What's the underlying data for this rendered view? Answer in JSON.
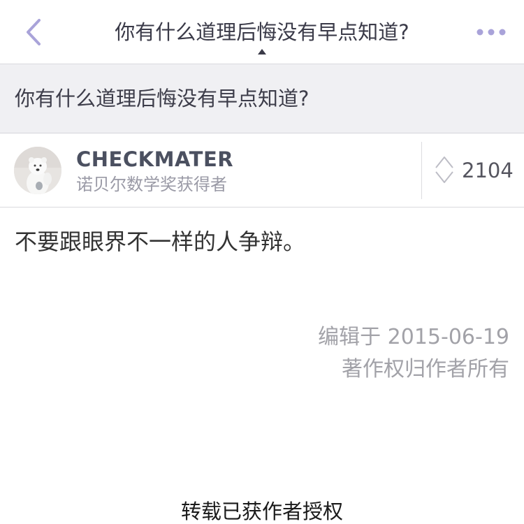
{
  "navbar": {
    "back_icon": "chevron-left-icon",
    "title": "你有什么道理后悔没有早点知道?",
    "more_icon": "ellipsis-icon"
  },
  "question": {
    "text": "你有什么道理后悔没有早点知道?"
  },
  "author": {
    "name": "CHECKMATER",
    "title": "诺贝尔数学奖获得者",
    "avatar_icon": "polar-bear-avatar"
  },
  "votes": {
    "icon": "vote-arrows-icon",
    "count": "2104"
  },
  "answer": {
    "text": "不要跟眼界不一样的人争辩。",
    "edited": "编辑于 2015-06-19",
    "copyright": "著作权归作者所有"
  },
  "footer": {
    "note": "转载已获作者授权"
  },
  "colors": {
    "accent": "#a9a3d9",
    "band": "#f0f0f3",
    "meta_text": "#a2a2a8"
  }
}
